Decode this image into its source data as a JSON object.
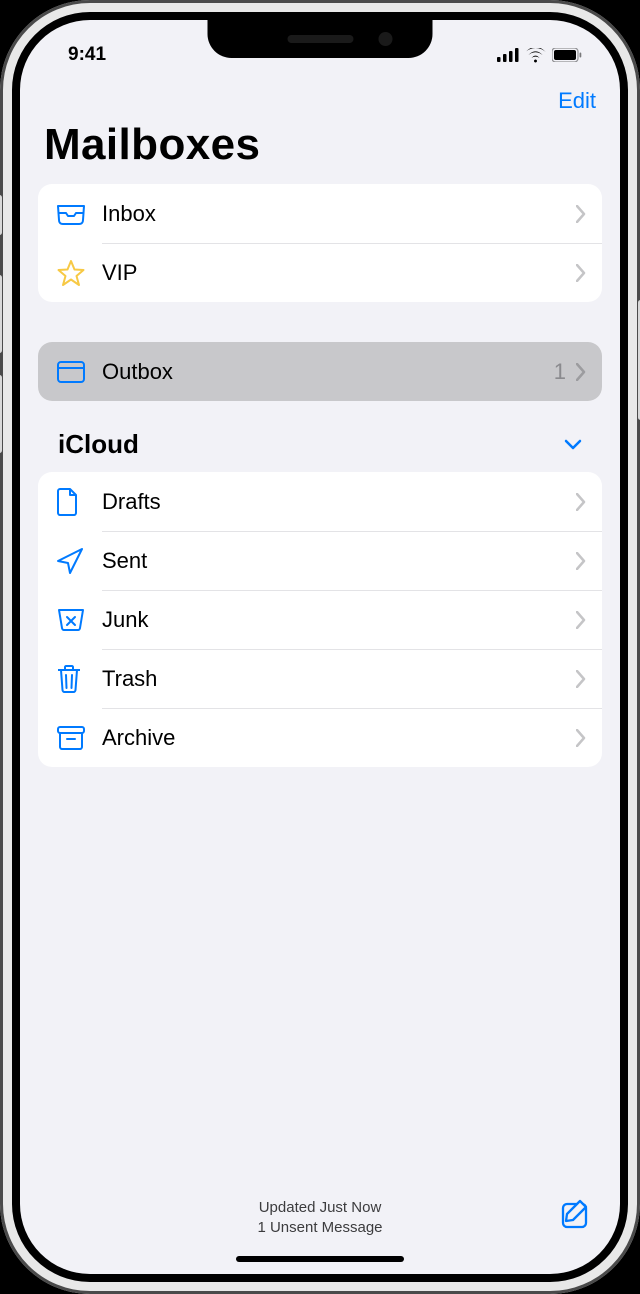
{
  "status": {
    "time": "9:41"
  },
  "nav": {
    "edit": "Edit"
  },
  "title": "Mailboxes",
  "primary": [
    {
      "label": "Inbox",
      "icon": "inbox-icon"
    },
    {
      "label": "VIP",
      "icon": "star-icon"
    }
  ],
  "outbox": {
    "label": "Outbox",
    "count": "1",
    "icon": "folder-icon"
  },
  "account": {
    "name": "iCloud",
    "folders": [
      {
        "label": "Drafts",
        "icon": "doc-icon"
      },
      {
        "label": "Sent",
        "icon": "paperplane-icon"
      },
      {
        "label": "Junk",
        "icon": "junk-icon"
      },
      {
        "label": "Trash",
        "icon": "trash-icon"
      },
      {
        "label": "Archive",
        "icon": "archive-icon"
      }
    ]
  },
  "toolbar": {
    "status_line1": "Updated Just Now",
    "status_line2": "1 Unsent Message"
  },
  "colors": {
    "accent": "#007aff",
    "star": "#f7c945"
  }
}
